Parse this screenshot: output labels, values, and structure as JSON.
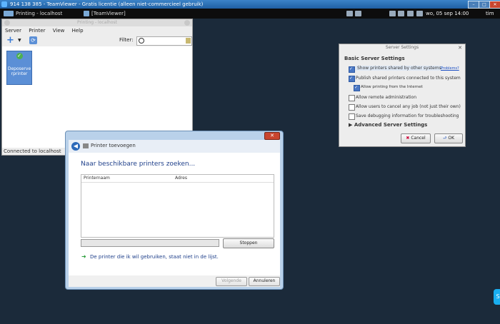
{
  "teamviewer": {
    "title": "914 138 385 - TeamViewer - Gratis licentie (alleen niet-commercieel gebruik)",
    "minimize": "–",
    "restore": "□",
    "close": "✕"
  },
  "taskbar": {
    "tasks": [
      "Printing - localhost",
      "[TeamViewer]"
    ],
    "clock": "wo, 05 sep  14:00",
    "right_tab": "tim"
  },
  "printing": {
    "title": "Printing - localhost",
    "menu": [
      "Server",
      "Printer",
      "View",
      "Help"
    ],
    "filter_label": "Filter:",
    "filter_value": "",
    "printer_name": "Deposerve rprinter",
    "status": "Connected to localhost"
  },
  "dialog": {
    "close": "✕",
    "header": "Printer toevoegen",
    "heading": "Naar beschikbare printers zoeken...",
    "columns": [
      "Printernaam",
      "Adres"
    ],
    "progress": 0.0,
    "stop": "Stoppen",
    "link": "De printer die ik wil gebruiken, staat niet in de lijst.",
    "next": "Volgende",
    "cancel": "Annuleren"
  },
  "server": {
    "title": "Server Settings",
    "close": "✕",
    "section": "Basic Server Settings",
    "options": [
      {
        "label": "Show printers shared by other systems",
        "checked": true
      },
      {
        "label": "Publish shared printers connected to this system",
        "checked": true
      },
      {
        "label": "Allow printing from the Internet",
        "checked": true
      },
      {
        "label": "Allow remote administration",
        "checked": false
      },
      {
        "label": "Allow users to cancel any job (not just their own)",
        "checked": false
      },
      {
        "label": "Save debugging information for troubleshooting",
        "checked": false
      }
    ],
    "problems": "Problems?",
    "advanced": "Advanced Server Settings",
    "cancel": "Cancel",
    "ok": "OK"
  },
  "colors": {
    "desktop": "#1b2a3a",
    "accent": "#3b83c8"
  }
}
